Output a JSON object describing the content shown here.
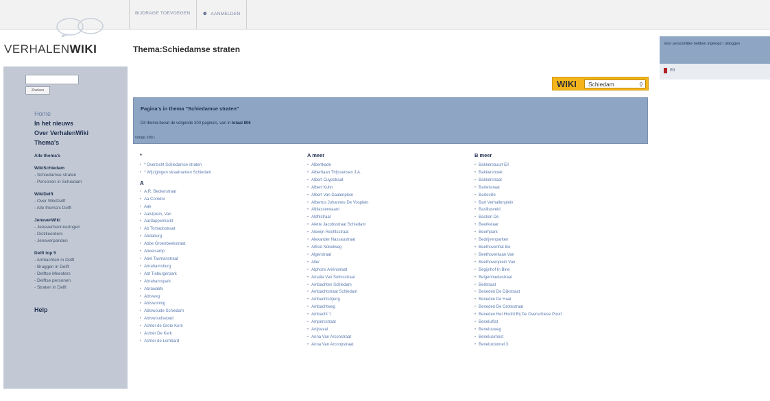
{
  "topbar": {
    "tabs": [
      {
        "label": "BIJDRAGE TOEVOEGEN"
      },
      {
        "label": "AANMELDEN"
      }
    ]
  },
  "logo": {
    "prefix": "VERHALEN",
    "suffix": "WIKI"
  },
  "page_title": "Thema:Schiedamse straten",
  "sidebar": {
    "search": {
      "value": "",
      "button_label": "Zoeken"
    },
    "main_links": [
      {
        "label": "Home"
      },
      {
        "label": "In het nieuws"
      },
      {
        "label": "Over VerhalenWiki"
      },
      {
        "label": "Thema's"
      }
    ],
    "all_themes": "Alle thema's",
    "sections": [
      {
        "title": "WikiSchiedam",
        "items": [
          "- Schiedamse straten",
          "- Personen in Schiedam"
        ]
      },
      {
        "title": "WikiDelft",
        "items": [
          "- Over WikiDelft",
          "- Alle thema's Delft"
        ]
      },
      {
        "title": "JeneverWiki",
        "items": [
          "- Jeneverherinneringen",
          "- Distilleerders",
          "- Jeneverpanden"
        ]
      },
      {
        "title": "Delft top 5",
        "items": [
          "- Ambachten in Delft",
          "- Bruggen in Delft",
          "- Delftse Meesters",
          "- Delftse personen",
          "- Straten in Delft"
        ]
      }
    ],
    "help": "Help"
  },
  "wiki_badge": {
    "wiki": "WIKI",
    "city": "Schiedam"
  },
  "theme_box": {
    "title": "Pagina's in thema \"Schiedamse straten\"",
    "count_text": "Dit thema bevat de volgende 200 pagina's, van in ",
    "count_total": "totaal 806",
    "prev": "vorige 200 |"
  },
  "columns": [
    {
      "head": "*",
      "groups": [
        {
          "letter": "",
          "items": [
            "* Overzicht Schiedamse straten",
            "* Wijzigingen straatnamen Schiedam"
          ]
        },
        {
          "letter": "A",
          "items": [
            "A.R. Beckerstraat",
            "Aa Corridor",
            "Aak",
            "Aalstplein, Van",
            "Aardappelmarkt",
            "Ab Tomadostraat",
            "Abdaburg",
            "Abbe Groenbeekstraat",
            "Abeelcamp",
            "Abel Tasmanstraat",
            "Abrahamsburg",
            "Abt Tieburgerpark",
            "Abrahamspark",
            "Abrawaldv",
            "Abtsweg",
            "Abtswoning",
            "Abtswoude Schiedam",
            "Abtswoudsepad",
            "Achter de Grote Kerk",
            "Achter De Kerk",
            "Achter de Lombard"
          ]
        }
      ]
    },
    {
      "head": "A meer",
      "groups": [
        {
          "letter": "",
          "items": [
            "Albertkade",
            "Albertlaan Thijssensen J.A.",
            "Albert Cuypstraat",
            "Albert Kuhn",
            "Albert Van Daalenplein",
            "Albertus Johannes De Vosplein",
            "Alblasserwaard",
            "Aldhlstraat",
            "Alette Jacobsstraat Schiedam",
            "Alewijn Rechtsstraat",
            "Alexander Nassaustraat",
            "Alfred Nobelweg",
            "Algerstraat",
            "Aller",
            "Alphons Ariënstraat",
            "Amalia Van Solmsstraat",
            "Ambachten Schiedam",
            "Ambachtstraat Schiedam",
            "Ambachtstrjeng",
            "Ambachtweg",
            "Ambacht 't",
            "Ampersstraat",
            "Anijseval",
            "Anna Van Arconstraat",
            "Anna Van Arconpstraat"
          ]
        }
      ]
    },
    {
      "head": "B meer",
      "groups": [
        {
          "letter": "",
          "items": [
            "Bakkersbuurt Ell",
            "Bakkershoek",
            "Bakkerstraat",
            "Bartelstraat",
            "Barteville",
            "Bart Verhallenplein",
            "Basiliusveld",
            "Bastion De",
            "Beerkelaar",
            "Beerhpark",
            "Bedrijvenparken",
            "Beethovenflat Ike",
            "Beethovenlaan Van",
            "Beethovenplein Van",
            "Begijnhof In Bine",
            "Belgenmedestraat",
            "Bellstraat",
            "Beneden De Dijkstraat",
            "Beneden De Haal",
            "Beneden De Grotestraat",
            "Beneden Het Hoofd Bij De Overschiese Poort",
            "Beneluiflat",
            "Benelusweg",
            "Benelusimost",
            "Beneluxtunnel 3"
          ]
        }
      ]
    }
  ],
  "right_panel": {
    "text": "Voor persoonlijke hebben ingelogd / uitloggen",
    "sub_label": "Ell"
  }
}
